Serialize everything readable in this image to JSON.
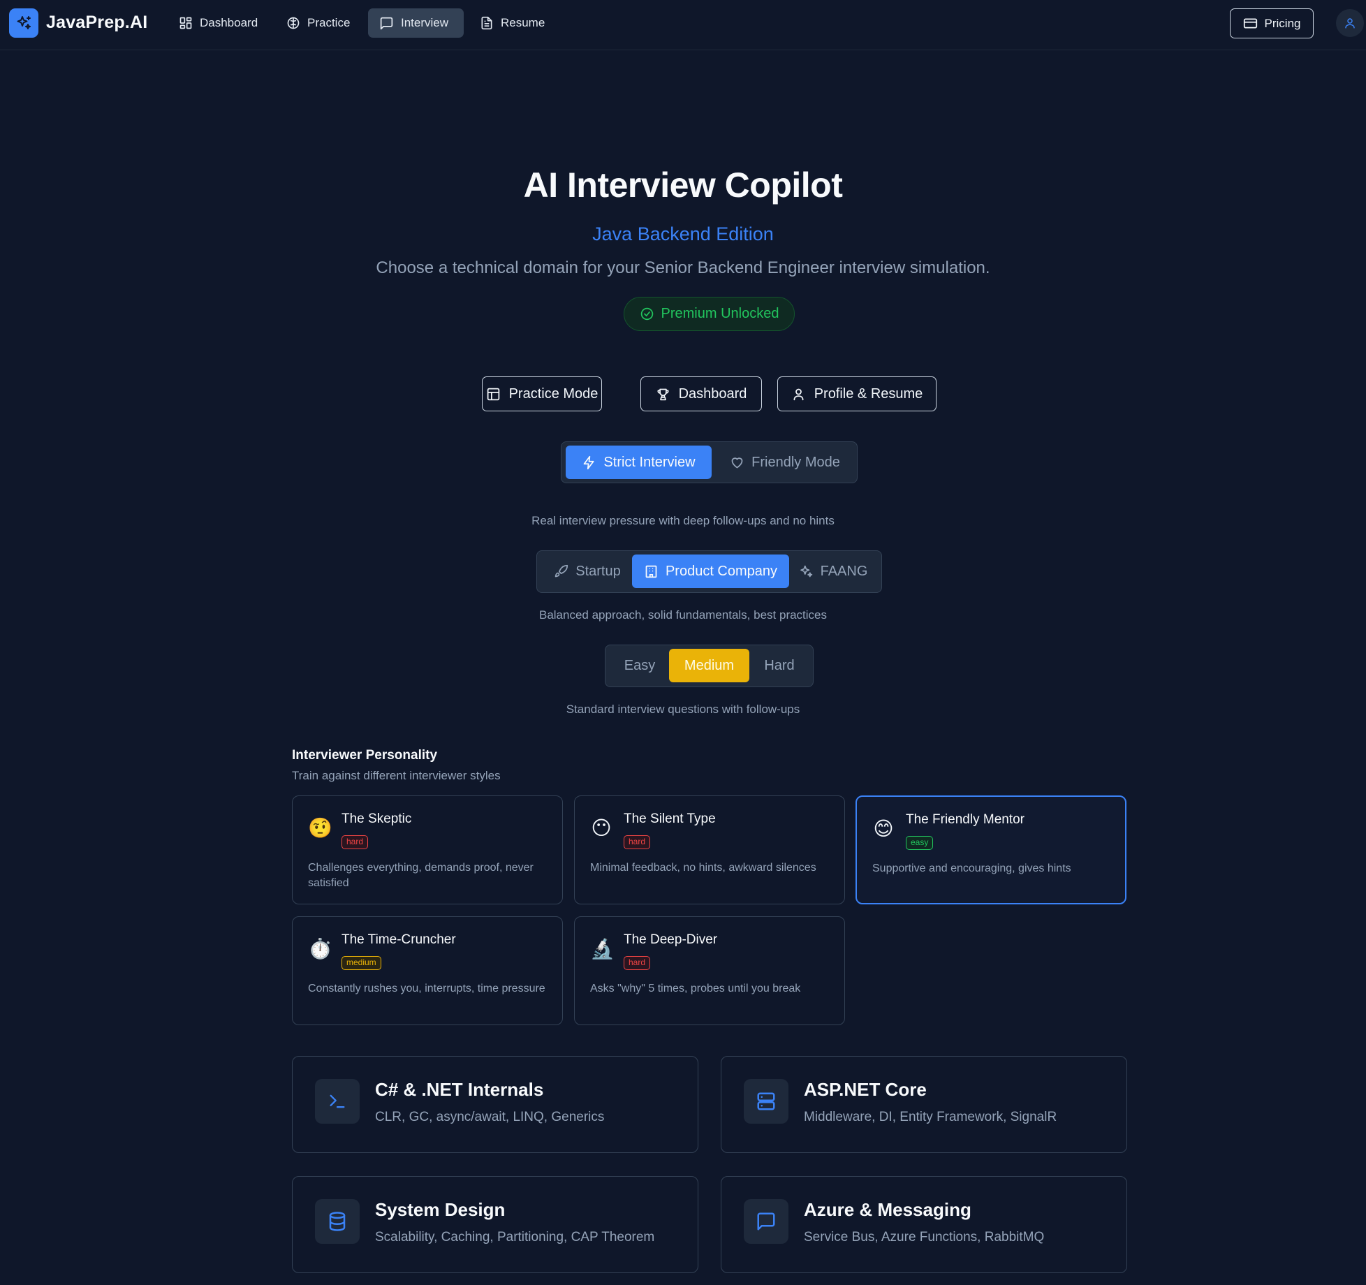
{
  "nav": {
    "brand": "JavaPrep.AI",
    "items": [
      {
        "label": "Dashboard",
        "icon": "layout-grid-icon"
      },
      {
        "label": "Practice",
        "icon": "brain-icon"
      },
      {
        "label": "Interview",
        "icon": "message-square-icon",
        "active": true
      },
      {
        "label": "Resume",
        "icon": "file-text-icon"
      }
    ],
    "pricing_label": "Pricing"
  },
  "hero": {
    "title": "AI Interview Copilot",
    "subtitle": "Java Backend Edition",
    "tagline": "Choose a technical domain for your Senior Backend Engineer interview simulation.",
    "premium_badge": "Premium Unlocked"
  },
  "quick_links": [
    {
      "label": "Practice Mode",
      "icon": "layout-icon"
    },
    {
      "label": "Dashboard",
      "icon": "trophy-icon"
    },
    {
      "label": "Profile & Resume",
      "icon": "user-icon"
    }
  ],
  "interview_mode": {
    "options": [
      "Strict Interview",
      "Friendly Mode"
    ],
    "selected": "Strict Interview",
    "description": "Real interview pressure with deep follow-ups and no hints"
  },
  "company_type": {
    "options": [
      "Startup",
      "Product Company",
      "FAANG"
    ],
    "selected": "Product Company",
    "description": "Balanced approach, solid fundamentals, best practices"
  },
  "difficulty": {
    "options": [
      "Easy",
      "Medium",
      "Hard"
    ],
    "selected": "Medium",
    "description": "Standard interview questions with follow-ups"
  },
  "personality": {
    "title": "Interviewer Personality",
    "subtitle": "Train against different interviewer styles",
    "cards": [
      {
        "emoji": "🤨",
        "name": "The Skeptic",
        "level": "hard",
        "desc": "Challenges everything, demands proof, never satisfied"
      },
      {
        "emoji": "😶",
        "name": "The Silent Type",
        "level": "hard",
        "desc": "Minimal feedback, no hints, awkward silences"
      },
      {
        "emoji": "😊",
        "name": "The Friendly Mentor",
        "level": "easy",
        "desc": "Supportive and encouraging, gives hints",
        "selected": true
      },
      {
        "emoji": "⏱️",
        "name": "The Time-Cruncher",
        "level": "medium",
        "desc": "Constantly rushes you, interrupts, time pressure"
      },
      {
        "emoji": "🔬",
        "name": "The Deep-Diver",
        "level": "hard",
        "desc": "Asks \"why\" 5 times, probes until you break"
      }
    ]
  },
  "domains": [
    {
      "title": "C# & .NET Internals",
      "desc": "CLR, GC, async/await, LINQ, Generics",
      "icon": "terminal-icon"
    },
    {
      "title": "ASP.NET Core",
      "desc": "Middleware, DI, Entity Framework, SignalR",
      "icon": "server-icon"
    },
    {
      "title": "System Design",
      "desc": "Scalability, Caching, Partitioning, CAP Theorem",
      "icon": "database-icon"
    },
    {
      "title": "Azure & Messaging",
      "desc": "Service Bus, Azure Functions, RabbitMQ",
      "icon": "message-square-icon"
    }
  ],
  "colors": {
    "background": "#0f172a",
    "accent": "#3b82f6",
    "selected_difficulty": "#eab308",
    "premium": "#22c55e",
    "hard": "#ef4444"
  }
}
